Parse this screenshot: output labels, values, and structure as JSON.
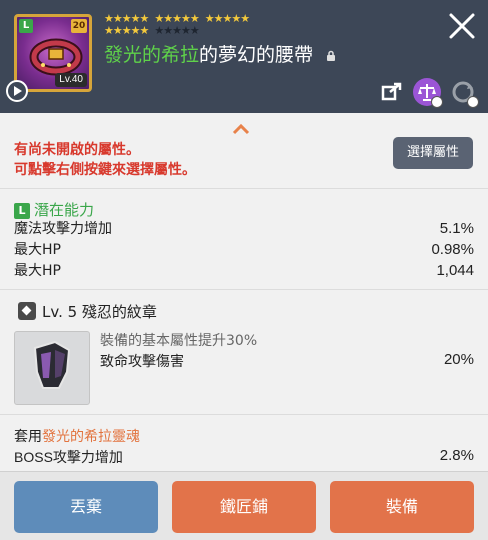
{
  "item": {
    "grade": "L",
    "enhance": "20",
    "level": "Lv.40",
    "stars_filled": 20,
    "stars_total": 25,
    "name_highlight": "發光的希拉",
    "name_rest": "的夢幻的腰帶",
    "name_color": "#5fd24a",
    "icons": [
      "share-icon",
      "balance-icon",
      "cycle-icon"
    ]
  },
  "notice": {
    "line1": "有尚未開啟的屬性。",
    "line2": "可點擊右側按鍵來選擇屬性。",
    "button": "選擇屬性"
  },
  "potential": {
    "grade": "L",
    "title": "潛在能力",
    "rows": [
      {
        "label": "魔法攻擊力增加",
        "value": "5.1%"
      },
      {
        "label": "最大HP",
        "value": "0.98%"
      },
      {
        "label": "最大HP",
        "value": "1,044"
      }
    ]
  },
  "emblem": {
    "title": "Lv. 5 殘忍的紋章",
    "desc": "裝備的基本屬性提升30%",
    "label": "致命攻擊傷害",
    "value": "20%"
  },
  "soul": {
    "prefix": "套用",
    "name": "發光的希拉靈魂",
    "label": "BOSS攻擊力增加",
    "value": "2.8%"
  },
  "buttons": {
    "discard": "丟棄",
    "smith": "鐵匠鋪",
    "equip": "裝備"
  }
}
